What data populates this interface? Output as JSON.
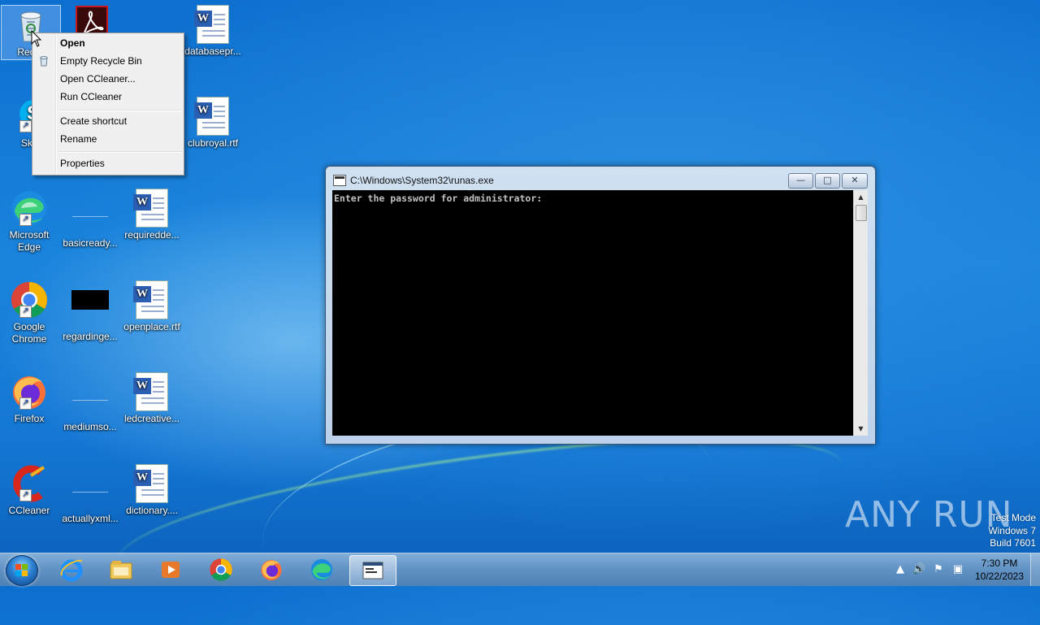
{
  "desktop": {
    "icons": [
      {
        "label": "Recyc",
        "icon": "recycle-bin-icon"
      },
      {
        "label": "",
        "icon": "acrobat-reader-icon"
      },
      {
        "label": "databasepr...",
        "icon": "word-document-icon"
      },
      {
        "label": "Sky",
        "icon": "skype-icon"
      },
      {
        "label": "clubroyal.rtf",
        "icon": "word-document-icon"
      },
      {
        "label": "Microsoft Edge",
        "icon": "edge-icon"
      },
      {
        "label": "basicready...",
        "icon": "blank-file-icon"
      },
      {
        "label": "requiredde...",
        "icon": "word-document-icon"
      },
      {
        "label": "Google Chrome",
        "icon": "chrome-icon"
      },
      {
        "label": "regardinge...",
        "icon": "black-image-icon"
      },
      {
        "label": "openplace.rtf",
        "icon": "word-document-icon"
      },
      {
        "label": "Firefox",
        "icon": "firefox-icon"
      },
      {
        "label": "mediumso...",
        "icon": "blank-file-icon"
      },
      {
        "label": "ledcreative...",
        "icon": "word-document-icon"
      },
      {
        "label": "CCleaner",
        "icon": "ccleaner-icon"
      },
      {
        "label": "actuallyxml...",
        "icon": "blank-file-icon"
      },
      {
        "label": "dictionary....",
        "icon": "word-document-icon"
      }
    ]
  },
  "context_menu": {
    "items": [
      {
        "label": "Open",
        "bold": true
      },
      {
        "label": "Empty Recycle Bin",
        "icon": "recycle-bin-icon"
      },
      {
        "label": "Open CCleaner..."
      },
      {
        "label": "Run CCleaner"
      },
      {
        "label": "Create shortcut"
      },
      {
        "label": "Rename"
      },
      {
        "label": "Properties"
      }
    ]
  },
  "console": {
    "title": "C:\\Windows\\System32\\runas.exe",
    "output": "Enter the password for administrator:",
    "minimize": "—",
    "maximize": "□",
    "close": "✕"
  },
  "watermark": {
    "text": "ANY RUN"
  },
  "system_info": {
    "line1": "Test Mode",
    "line2": "Windows 7",
    "line3": "Build 7601"
  },
  "taskbar": {
    "apps": [
      {
        "name": "Internet Explorer",
        "icon": "ie-icon"
      },
      {
        "name": "Windows Explorer",
        "icon": "folder-icon"
      },
      {
        "name": "Media Player",
        "icon": "media-player-icon"
      },
      {
        "name": "Google Chrome",
        "icon": "chrome-icon"
      },
      {
        "name": "Firefox",
        "icon": "firefox-icon"
      },
      {
        "name": "Microsoft Edge",
        "icon": "edge-icon"
      },
      {
        "name": "runas.exe",
        "icon": "console-icon",
        "active": true
      }
    ],
    "time": "7:30 PM",
    "date": "10/22/2023"
  },
  "colors": {
    "desktop_blue": "#1477d4",
    "console_bg": "#000000",
    "console_text": "#c0c0c0",
    "menu_bg": "#f0f0f0"
  }
}
